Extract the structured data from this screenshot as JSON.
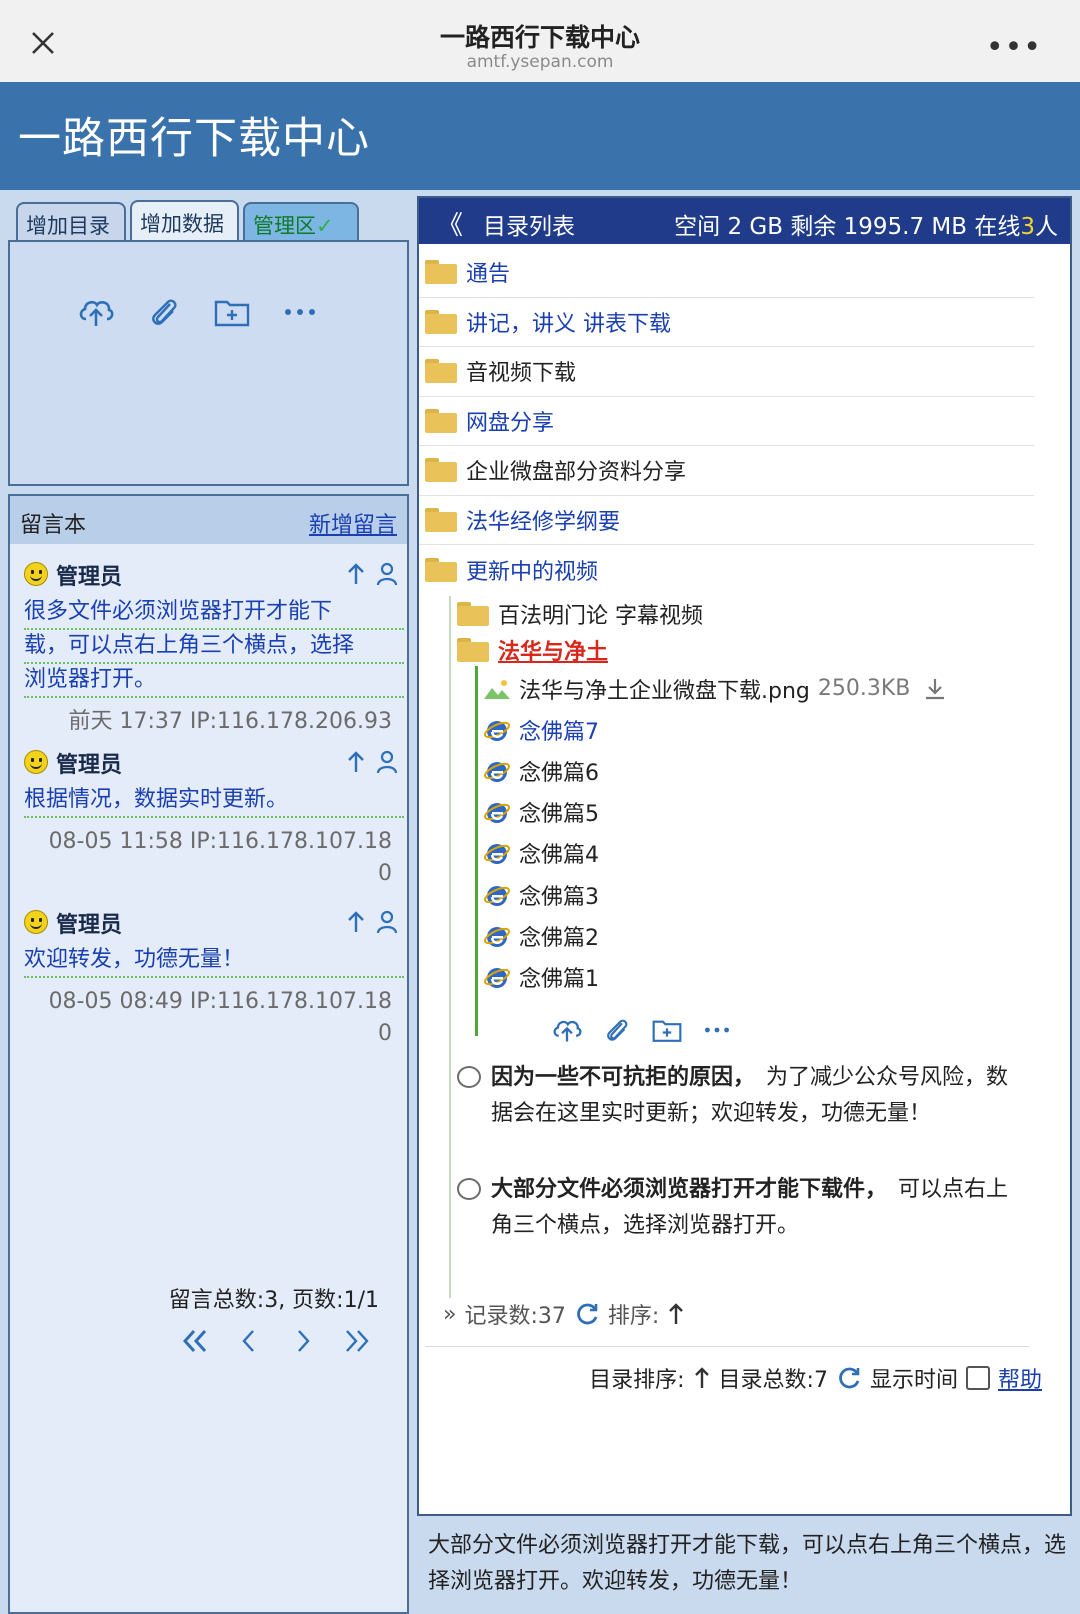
{
  "browser": {
    "title": "一路西行下载中心",
    "url": "amtf.ysepan.com",
    "more": "•••"
  },
  "site": {
    "title": "一路西行下载中心"
  },
  "left": {
    "tabs": [
      "增加目录",
      "增加数据",
      "管理区"
    ],
    "guestbook": {
      "title": "留言本",
      "new_link": "新增留言",
      "messages": [
        {
          "author": "管理员",
          "lines": [
            "很多文件必须浏览器打开才能下",
            "载，可以点右上角三个横点，选择",
            "浏览器打开。"
          ],
          "meta": [
            "前天 17:37 IP:116.178.206.93"
          ]
        },
        {
          "author": "管理员",
          "lines": [
            "根据情况，数据实时更新。"
          ],
          "meta": [
            "08-05 11:58 IP:116.178.107.18",
            "0"
          ]
        },
        {
          "author": "管理员",
          "lines": [
            "欢迎转发，功德无量！"
          ],
          "meta": [
            "08-05 08:49 IP:116.178.107.18",
            "0"
          ]
        }
      ],
      "total": "留言总数:3, 页数:1/1"
    }
  },
  "right": {
    "header": {
      "back": "《",
      "label": "目录列表",
      "space_prefix": "空间 2 GB  剩余 1995.7 MB  在线",
      "online": "3",
      "online_suffix": "人"
    },
    "folders": [
      {
        "label": "通告",
        "style": "blue"
      },
      {
        "label": "讲记，讲义 讲表下载",
        "style": "blue"
      },
      {
        "label": "音视频下载",
        "style": "dark"
      },
      {
        "label": "网盘分享",
        "style": "blue"
      },
      {
        "label": "企业微盘部分资料分享",
        "style": "dark"
      },
      {
        "label": "法华经修学纲要",
        "style": "blue"
      },
      {
        "label": "更新中的视频",
        "style": "blue"
      }
    ],
    "subfolders": [
      "百法明门论 字幕视频",
      "法华与净土"
    ],
    "files": [
      {
        "name": "法华与净土企业微盘下载.png",
        "size": "250.3KB",
        "type": "image"
      },
      {
        "name": "念佛篇7",
        "type": "link",
        "visited": true
      },
      {
        "name": "念佛篇6",
        "type": "link"
      },
      {
        "name": "念佛篇5",
        "type": "link"
      },
      {
        "name": "念佛篇4",
        "type": "link"
      },
      {
        "name": "念佛篇3",
        "type": "link"
      },
      {
        "name": "念佛篇2",
        "type": "link"
      },
      {
        "name": "念佛篇1",
        "type": "link"
      }
    ],
    "notices": [
      {
        "bold": "因为一些不可抗拒的原因，",
        "text": "　为了减少公众号风险，数据会在这里实时更新；欢迎转发，功德无量！"
      },
      {
        "bold": "大部分文件必须浏览器打开才能下载件，",
        "text": "　可以点右上角三个横点，选择浏览器打开。"
      }
    ],
    "records": {
      "prefix": "»",
      "label": "记录数:37",
      "sort": "排序:"
    },
    "dir_sort": {
      "label": "目录排序:",
      "count": "目录总数:7",
      "show_time": "显示时间",
      "help": "帮助"
    },
    "bottom_note": "大部分文件必须浏览器打开才能下载，可以点右上角三个横点，选择浏览器打开。欢迎转发，功德无量！"
  },
  "colors": {
    "header_bg": "#3a72ac",
    "dir_header_bg": "#1f3b8a",
    "link_blue": "#1a3fb0",
    "red": "#d7281b",
    "online_yellow": "#f6d331"
  }
}
